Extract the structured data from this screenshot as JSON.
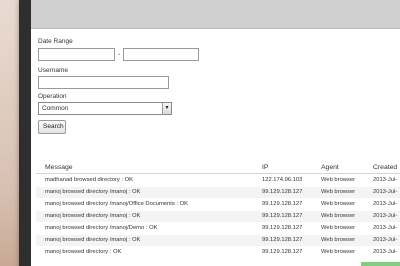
{
  "form": {
    "date_range_label": "Date Range",
    "date_separator": "-",
    "date_from_value": "",
    "date_to_value": "",
    "username_label": "Username",
    "username_value": "",
    "operation_label": "Operation",
    "operation_selected": "Common",
    "search_label": "Search"
  },
  "table": {
    "headers": {
      "message": "Message",
      "ip": "IP",
      "agent": "Agent",
      "created": "Created"
    },
    "rows": [
      {
        "message": "madhanad browsed directory : OK",
        "ip": "122.174.96.103",
        "agent": "Web browser",
        "created": "2013-Jul-"
      },
      {
        "message": "manoj browsed directory /manoj : OK",
        "ip": "99.129.128.127",
        "agent": "Web browser",
        "created": "2013-Jul-"
      },
      {
        "message": "manoj browsed directory /manoj/Office Documents : OK",
        "ip": "99.129.128.127",
        "agent": "Web browser",
        "created": "2013-Jul-"
      },
      {
        "message": "manoj browsed directory /manoj : OK",
        "ip": "99.129.128.127",
        "agent": "Web browser",
        "created": "2013-Jul-"
      },
      {
        "message": "manoj browsed directory /manoj/Demo : OK",
        "ip": "99.129.128.127",
        "agent": "Web browser",
        "created": "2013-Jul-"
      },
      {
        "message": "manoj browsed directory /manoj : OK",
        "ip": "99.129.128.127",
        "agent": "Web browser",
        "created": "2013-Jul-"
      },
      {
        "message": "manoj browsed directory : OK",
        "ip": "99.129.128.127",
        "agent": "Web browser",
        "created": "2013-Jul-"
      }
    ]
  },
  "icons": {
    "select_arrow": "chevron-down-icon"
  }
}
